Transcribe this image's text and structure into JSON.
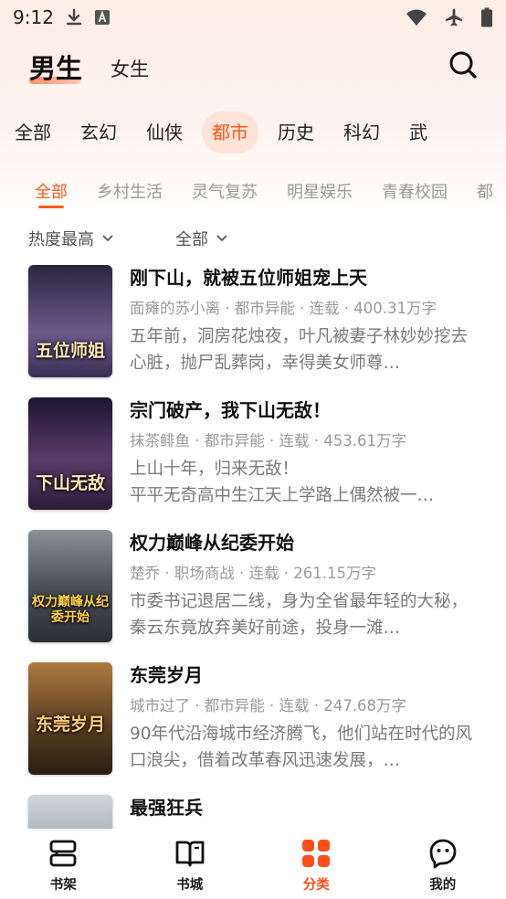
{
  "status_bar": {
    "time": "9:12"
  },
  "header": {
    "tabs": [
      {
        "label": "男生",
        "active": true
      },
      {
        "label": "女生",
        "active": false
      }
    ]
  },
  "categories": [
    "全部",
    "玄幻",
    "仙侠",
    "都市",
    "历史",
    "科幻",
    "武"
  ],
  "active_category": "都市",
  "subcategories": [
    "全部",
    "乡村生活",
    "灵气复苏",
    "明星娱乐",
    "青春校园",
    "都"
  ],
  "active_subcategory": "全部",
  "filters": {
    "sort": "热度最高",
    "status": "全部"
  },
  "books": [
    {
      "title": "刚下山，就被五位师姐宠上天",
      "meta": "面瘫的苏小离 · 都市异能 · 连载 · 400.31万字",
      "desc": "五年前，洞房花烛夜，叶凡被妻子林妙妙挖去心脏，抛尸乱葬岗，幸得美女师尊…",
      "cover_text": "五位师姐",
      "cover_colors": [
        "#2a2540",
        "#6a5a8a"
      ]
    },
    {
      "title": "宗门破产，我下山无敌！",
      "meta": "抹茶鲱鱼 · 都市异能 · 连载 · 453.61万字",
      "desc": "上山十年，归来无敌！\n平平无奇高中生江天上学路上偶然被一…",
      "cover_text": "下山无敌",
      "cover_colors": [
        "#2b1d3a",
        "#8a4a6a"
      ]
    },
    {
      "title": "权力巅峰从纪委开始",
      "meta": "楚乔 · 职场商战 · 连载 · 261.15万字",
      "desc": "市委书记退居二线，身为全省最年轻的大秘，秦云东竟放弃美好前途，投身一滩…",
      "cover_text": "权力巅峰从纪委开始",
      "cover_colors": [
        "#3a3f48",
        "#8a9098"
      ]
    },
    {
      "title": "东莞岁月",
      "meta": "城市过了 · 都市异能 · 连载 · 247.68万字",
      "desc": "90年代沿海城市经济腾飞，他们站在时代的风口浪尖，借着改革春风迅速发展，…",
      "cover_text": "东莞岁月",
      "cover_colors": [
        "#3a2a1a",
        "#b07a40"
      ]
    },
    {
      "title": "最强狂兵",
      "meta": "",
      "desc": "",
      "cover_text": "",
      "cover_colors": [
        "#6a7580",
        "#cfd6dd"
      ]
    }
  ],
  "bottom_nav": [
    {
      "label": "书架",
      "icon": "bookshelf-icon",
      "active": false
    },
    {
      "label": "书城",
      "icon": "open-book-icon",
      "active": false
    },
    {
      "label": "分类",
      "icon": "category-grid-icon",
      "active": true
    },
    {
      "label": "我的",
      "icon": "profile-icon",
      "active": false
    }
  ],
  "colors": {
    "accent": "#ff5a1f",
    "active_pill": "#fde3d8"
  }
}
